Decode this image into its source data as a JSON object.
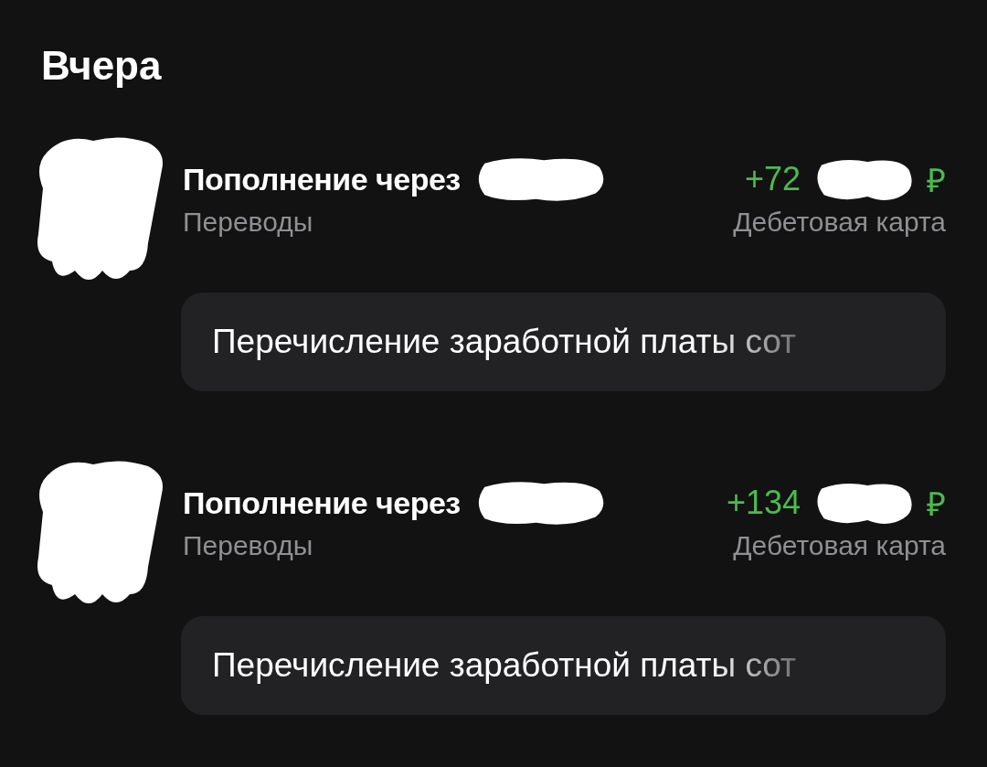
{
  "section_title": "Вчера",
  "transactions": [
    {
      "title": "Пополнение через",
      "amount": "+72",
      "currency": "₽",
      "category": "Переводы",
      "account": "Дебетовая карта",
      "note": "Перечисление заработной платы сот"
    },
    {
      "title": "Пополнение через",
      "amount": "+134",
      "currency": "₽",
      "category": "Переводы",
      "account": "Дебетовая карта",
      "note": "Перечисление заработной платы сот"
    }
  ]
}
